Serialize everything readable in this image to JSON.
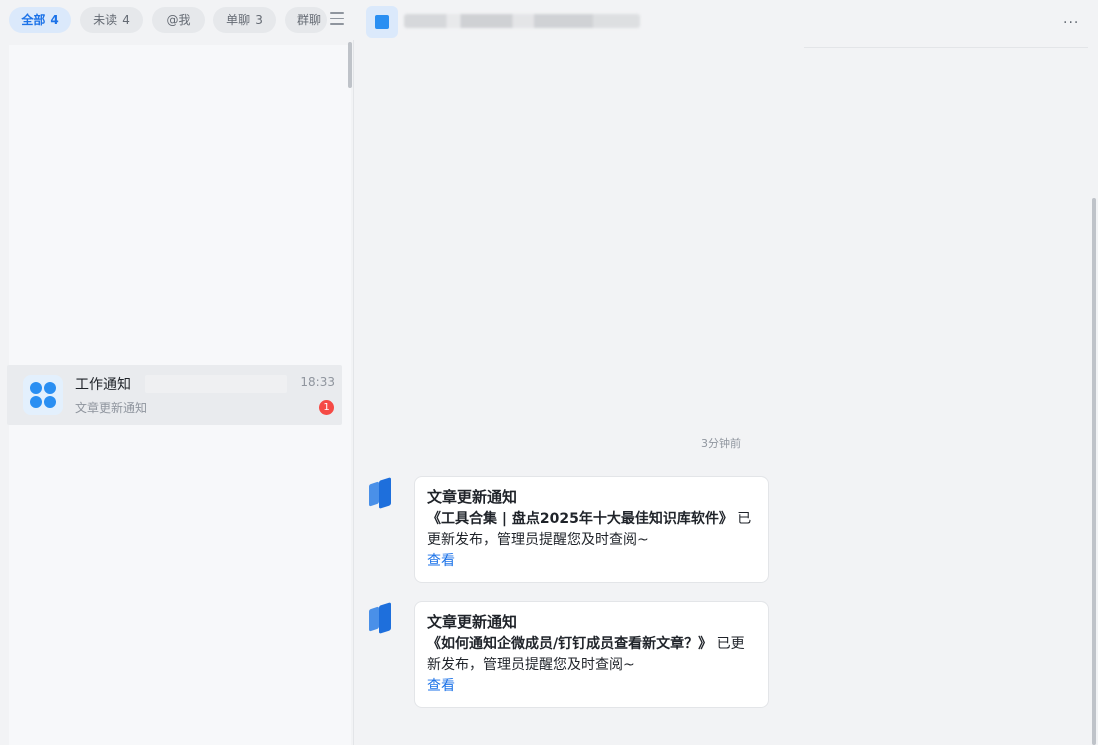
{
  "filters": [
    {
      "label": "全部",
      "count": "4",
      "active": true
    },
    {
      "label": "未读",
      "count": "4"
    },
    {
      "label": "@我",
      "count": ""
    },
    {
      "label": "单聊",
      "count": "3"
    },
    {
      "label": "群聊",
      "count": ""
    }
  ],
  "conversation": {
    "title": "工作通知",
    "time": "18:33",
    "preview": "文章更新通知",
    "unread": "1"
  },
  "chat": {
    "more": "···",
    "timestamp": "3分钟前",
    "messages": [
      {
        "title": "文章更新通知",
        "article": "《工具合集 | 盘点2025年十大最佳知识库软件》",
        "suffix": " 已更新发布，管理员提醒您及时查阅~",
        "link": "查看"
      },
      {
        "title": "文章更新通知",
        "article": "《如何通知企微成员/钉钉成员查看新文章？》",
        "suffix": " 已更新发布，管理员提醒您及时查阅~",
        "link": "查看"
      }
    ]
  },
  "colors": {
    "accent": "#1b72e8",
    "badge": "#f54a45",
    "background": "#f2f3f5"
  }
}
